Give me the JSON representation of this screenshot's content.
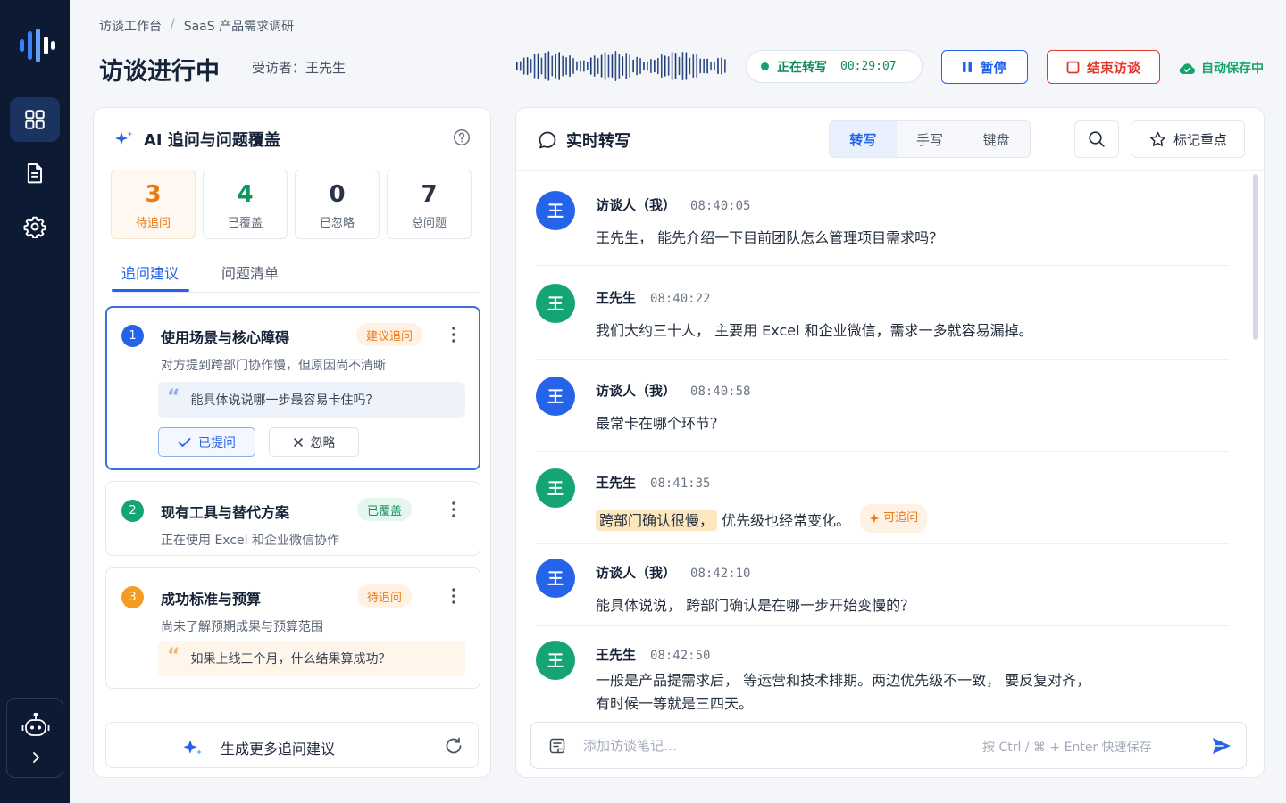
{
  "sidebar": {
    "items": [
      {
        "icon": "grid-icon",
        "active": true
      },
      {
        "icon": "document-icon",
        "active": false
      },
      {
        "icon": "gear-icon",
        "active": false
      }
    ],
    "assistant_icon": "robot-icon",
    "expand_icon": "chevron-right-icon"
  },
  "header": {
    "breadcrumb": [
      "访谈工作台",
      "/",
      "SaaS 产品需求调研"
    ],
    "title": "访谈进行中",
    "interviewee": "受访者：王先生",
    "status_label": "正在转写",
    "timer": "00:29:07",
    "pause_label": "暂停",
    "end_label": "结束访谈",
    "autosave_label": "自动保存中"
  },
  "ai_panel": {
    "title": "AI 追问与问题覆盖",
    "stats": [
      {
        "value": "3",
        "label": "待追问",
        "color": "#ea7a15"
      },
      {
        "value": "4",
        "label": "已覆盖",
        "color": "#13945f"
      },
      {
        "value": "0",
        "label": "已忽略",
        "color": "#2b3445"
      },
      {
        "value": "7",
        "label": "总问题",
        "color": "#2b3445"
      }
    ],
    "tabs": [
      "追问建议",
      "问题清单"
    ],
    "questions": [
      {
        "num": "1",
        "title": "使用场景与核心障碍",
        "badge": "建议追问",
        "desc": "对方提到跨部门协作慢，但原因尚不清晰",
        "quote": "能具体说说哪一步最容易卡住吗？",
        "asked_label": "已提问",
        "ignore_label": "忽略"
      },
      {
        "num": "2",
        "title": "现有工具与替代方案",
        "badge": "已覆盖",
        "desc": "正在使用 Excel 和企业微信协作"
      },
      {
        "num": "3",
        "title": "成功标准与预算",
        "badge": "待追问",
        "desc": "尚未了解预期成果与预算范围",
        "quote": "如果上线三个月，什么结果算成功？"
      }
    ],
    "generate_label": "生成更多追问建议"
  },
  "transcript": {
    "title": "实时转写",
    "modes": [
      "转写",
      "手写",
      "键盘"
    ],
    "mark_label": "标记重点",
    "messages": [
      {
        "avatar": "王",
        "speaker": "访谈人（我）",
        "time": "08:40:05",
        "text": "王先生， 能先介绍一下目前团队怎么管理项目需求吗？"
      },
      {
        "avatar": "王",
        "speaker": "王先生",
        "time": "08:40:22",
        "text": "我们大约三十人， 主要用 Excel 和企业微信，需求一多就容易漏掉。"
      },
      {
        "avatar": "王",
        "speaker": "访谈人（我）",
        "time": "08:40:58",
        "text": "最常卡在哪个环节？"
      },
      {
        "avatar": "王",
        "speaker": "王先生",
        "time": "08:41:35",
        "highlight": "跨部门确认很慢，",
        "text": "优先级也经常变化。",
        "tag": "可追问"
      },
      {
        "avatar": "王",
        "speaker": "访谈人（我）",
        "time": "08:42:10",
        "text": "能具体说说， 跨部门确认是在哪一步开始变慢的？"
      },
      {
        "avatar": "王",
        "speaker": "王先生",
        "time": "08:42:50",
        "text": "一般是产品提需求后， 等运营和技术排期。两边优先级不一致， 要反复对齐，",
        "text2": "有时候一等就是三四天。"
      }
    ],
    "note_placeholder": "添加访谈笔记…",
    "note_hint": "按 Ctrl / ⌘ + Enter 快速保存"
  },
  "colors": {
    "sidebar": "#0c1a33",
    "primary": "#2563eb",
    "danger": "#e0392f",
    "success": "#16a36a",
    "warning": "#ea7a15"
  }
}
